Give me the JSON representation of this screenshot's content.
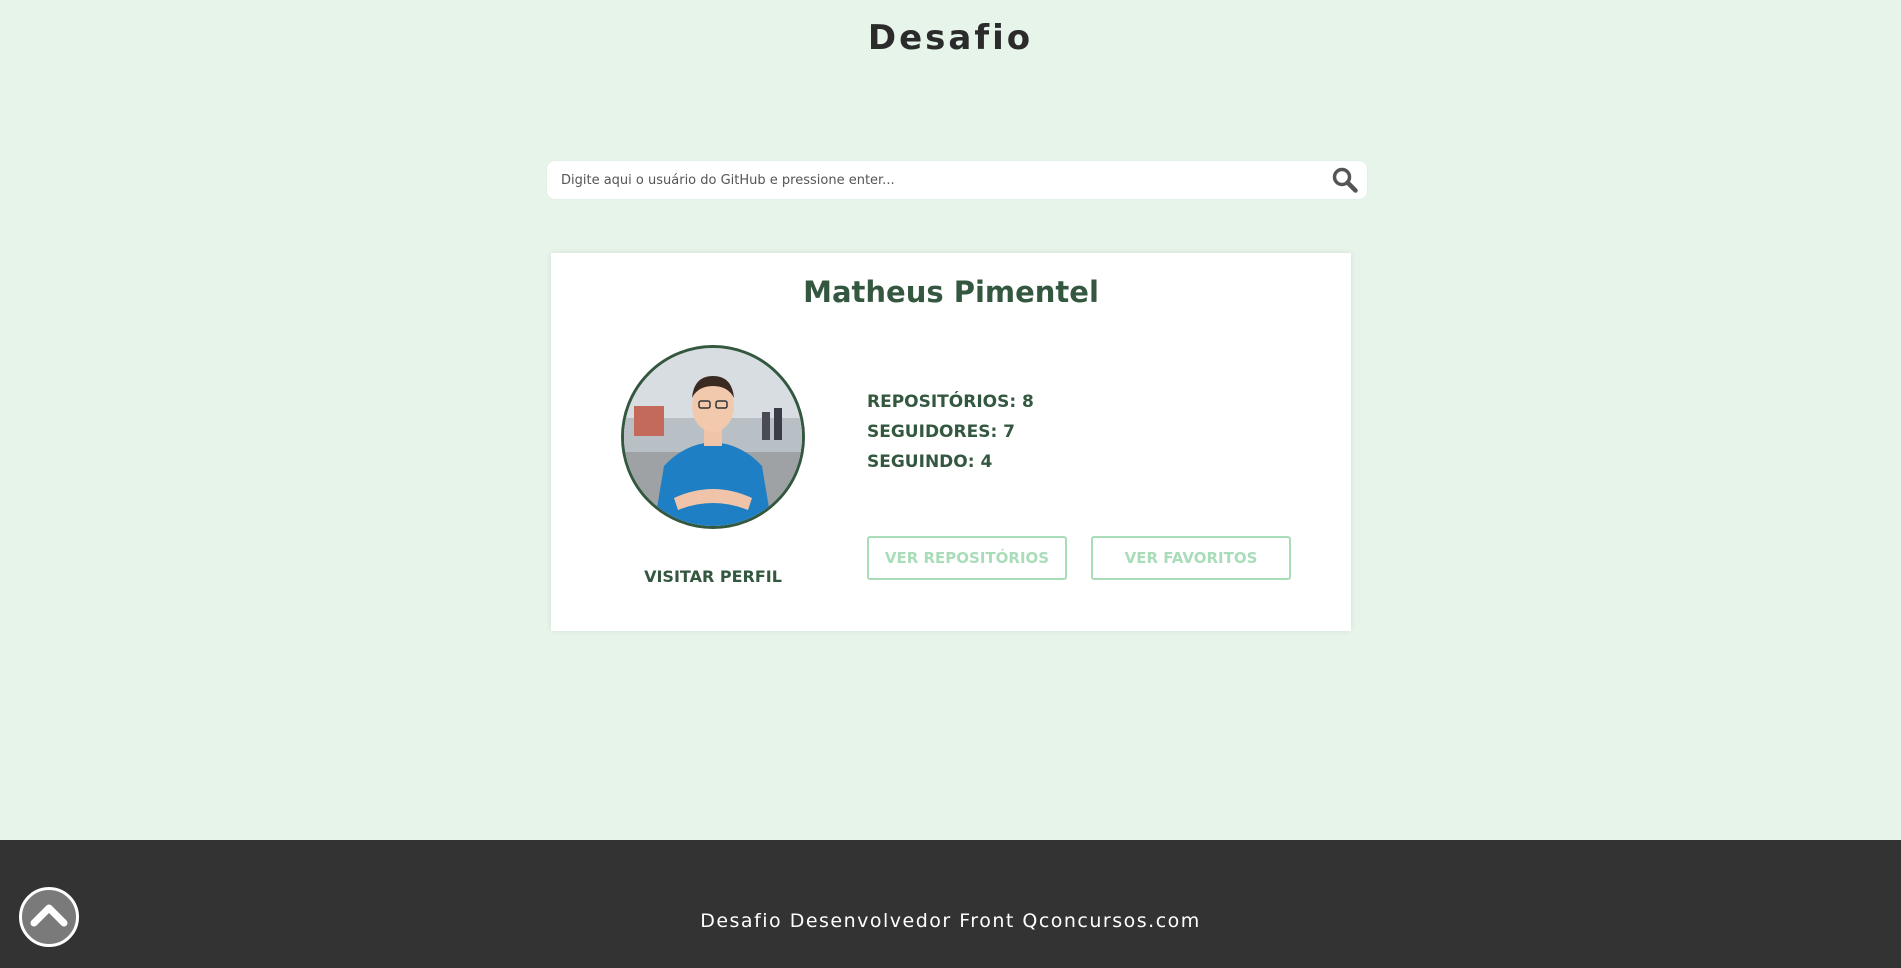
{
  "header": {
    "title": "Desafio"
  },
  "search": {
    "placeholder": "Digite aqui o usuário do GitHub e pressione enter...",
    "value": "",
    "icon": "search-icon"
  },
  "profile": {
    "name": "Matheus Pimentel",
    "avatar_icon": "avatar",
    "visit_label": "VISITAR PERFIL",
    "stats": [
      {
        "label": "REPOSITÓRIOS: 8"
      },
      {
        "label": "SEGUIDORES: 7"
      },
      {
        "label": "SEGUINDO: 4"
      }
    ],
    "buttons": {
      "repos_label": "VER REPOSITÓRIOS",
      "favs_label": "VER FAVORITOS"
    }
  },
  "footer": {
    "text": "Desafio Desenvolvedor Front Qconcursos.com",
    "back_to_top_icon": "chevron-up-icon"
  },
  "colors": {
    "background": "#e6f4ea",
    "accent_dark_green": "#33573f",
    "button_light_green": "#a9dcb9",
    "footer": "#333333"
  }
}
